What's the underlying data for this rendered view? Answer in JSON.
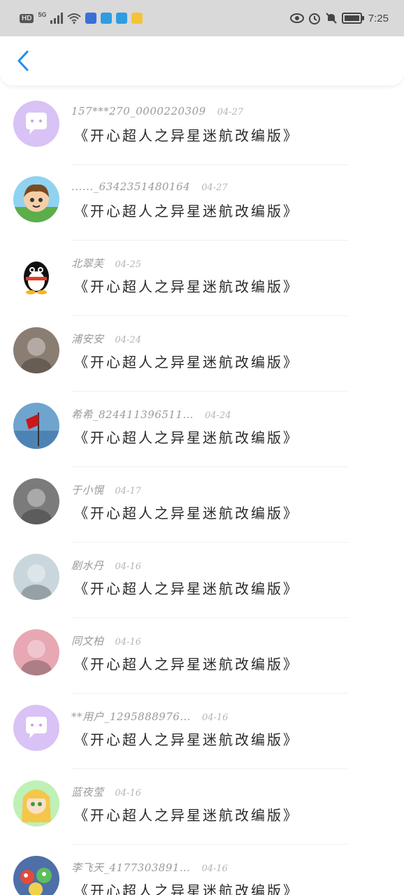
{
  "status_bar": {
    "left": {
      "hd": "HD",
      "network": "5G"
    },
    "right": {
      "time": "7:25"
    },
    "icons": [
      "signal-icon",
      "wifi-icon",
      "app-icon",
      "telegram-icon",
      "telegram-icon",
      "app-icon",
      "eye-icon",
      "alarm-icon",
      "mute-icon",
      "battery-icon"
    ]
  },
  "header": {
    "back_icon": "chevron-left-icon"
  },
  "messages": [
    {
      "name": "157***270_0000220309",
      "date": "04-27",
      "text": "《开心超人之异星迷航改编版》",
      "avatar": "default-chat-avatar",
      "color": "#d9c2f5"
    },
    {
      "name": "......_6342351480164",
      "date": "04-27",
      "text": "《开心超人之异星迷航改编版》",
      "avatar": "cartoon-boy-avatar",
      "color": "#8fd3f0"
    },
    {
      "name": "北翠芙",
      "date": "04-25",
      "text": "《开心超人之异星迷航改编版》",
      "avatar": "qq-penguin-avatar",
      "color": "#ffffff"
    },
    {
      "name": "浦安安",
      "date": "04-24",
      "text": "《开心超人之异星迷航改编版》",
      "avatar": "photo-avatar",
      "color": "#8a7d72"
    },
    {
      "name": "希希_824411396511…",
      "date": "04-24",
      "text": "《开心超人之异星迷航改编版》",
      "avatar": "flag-photo-avatar",
      "color": "#6fa4cf"
    },
    {
      "name": "于小愰",
      "date": "04-17",
      "text": "《开心超人之异星迷航改编版》",
      "avatar": "photo-avatar",
      "color": "#7b7b7b"
    },
    {
      "name": "剧水丹",
      "date": "04-16",
      "text": "《开心超人之异星迷航改编版》",
      "avatar": "photo-avatar",
      "color": "#c9d7dc"
    },
    {
      "name": "同文柏",
      "date": "04-16",
      "text": "《开心超人之异星迷航改编版》",
      "avatar": "photo-avatar",
      "color": "#e7a8b3"
    },
    {
      "name": "**用户_1295888976…",
      "date": "04-16",
      "text": "《开心超人之异星迷航改编版》",
      "avatar": "default-chat-avatar",
      "color": "#d9c2f5"
    },
    {
      "name": "蓝夜莹",
      "date": "04-16",
      "text": "《开心超人之异星迷航改编版》",
      "avatar": "anime-avatar",
      "color": "#bff0b5"
    },
    {
      "name": "李飞天_4177303891…",
      "date": "04-16",
      "text": "《开心超人之异星迷航改编版》",
      "avatar": "cartoon-avatar",
      "color": "#4f6fa8"
    }
  ]
}
